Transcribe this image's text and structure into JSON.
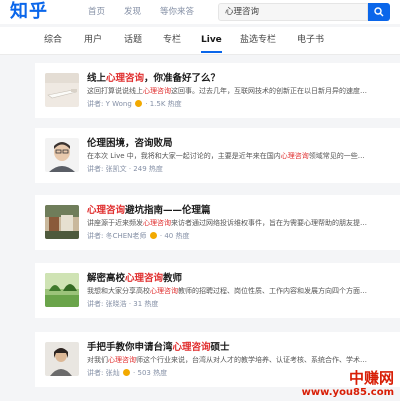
{
  "header": {
    "logo": "知乎",
    "nav": [
      "首页",
      "发现",
      "等你来答"
    ],
    "search_value": "心理咨询"
  },
  "tabs": [
    "综合",
    "用户",
    "话题",
    "专栏",
    "Live",
    "盐选专栏",
    "电子书"
  ],
  "active_tab": "Live",
  "cards": [
    {
      "title_pre": "线上",
      "title_hl": "心理咨询",
      "title_post": "，你准备好了么？",
      "desc_pre": "这回打算说说线上",
      "desc_hl": "心理咨询",
      "desc_post": "这回事。过去几年，互联网技术的创新正在以日新月异的速度…",
      "speaker": "讲者: Y Wong",
      "heat": "1.5K 热度"
    },
    {
      "title_pre": "伦理困境，咨询败局",
      "title_hl": "",
      "title_post": "",
      "desc_pre": "在本次 Live 中，我将和大家一起讨论的，主要是近年来在国内",
      "desc_hl": "心理咨询",
      "desc_post": "领域常见的一些…",
      "speaker": "讲者: 张凯文",
      "heat": "249 热度"
    },
    {
      "title_pre": "",
      "title_hl": "心理咨询",
      "title_post": "避坑指南——伦理篇",
      "desc_pre": "讲座源于近来频发",
      "desc_hl": "心理咨询",
      "desc_post": "来访者通过网络投诉维权事件，旨在为需要心理帮助的朋友提…",
      "speaker": "讲者: 冬CHEN老师",
      "heat": "40 热度"
    },
    {
      "title_pre": "解密高校",
      "title_hl": "心理咨询",
      "title_post": "教师",
      "desc_pre": "我想和大家分享高校",
      "desc_hl": "心理咨询",
      "desc_post": "教师的招聘过程、岗位性质、工作内容和发展方向四个方面…",
      "speaker": "讲者: 张晓浩",
      "heat": "31 热度"
    },
    {
      "title_pre": "手把手教你申请台湾",
      "title_hl": "心理咨询",
      "title_post": "硕士",
      "desc_pre": "对我们",
      "desc_hl": "心理咨询",
      "desc_post": "师这个行业来说，台湾从对人才的教学培养、认证考核、系统合作、学术…",
      "speaker": "讲者: 张灿",
      "heat": "503 热度"
    }
  ],
  "watermark": {
    "line1": "中赚网",
    "line2": "www.you85.com"
  },
  "colors": {
    "brand": "#0a66ea",
    "highlight": "#e02e2e"
  }
}
